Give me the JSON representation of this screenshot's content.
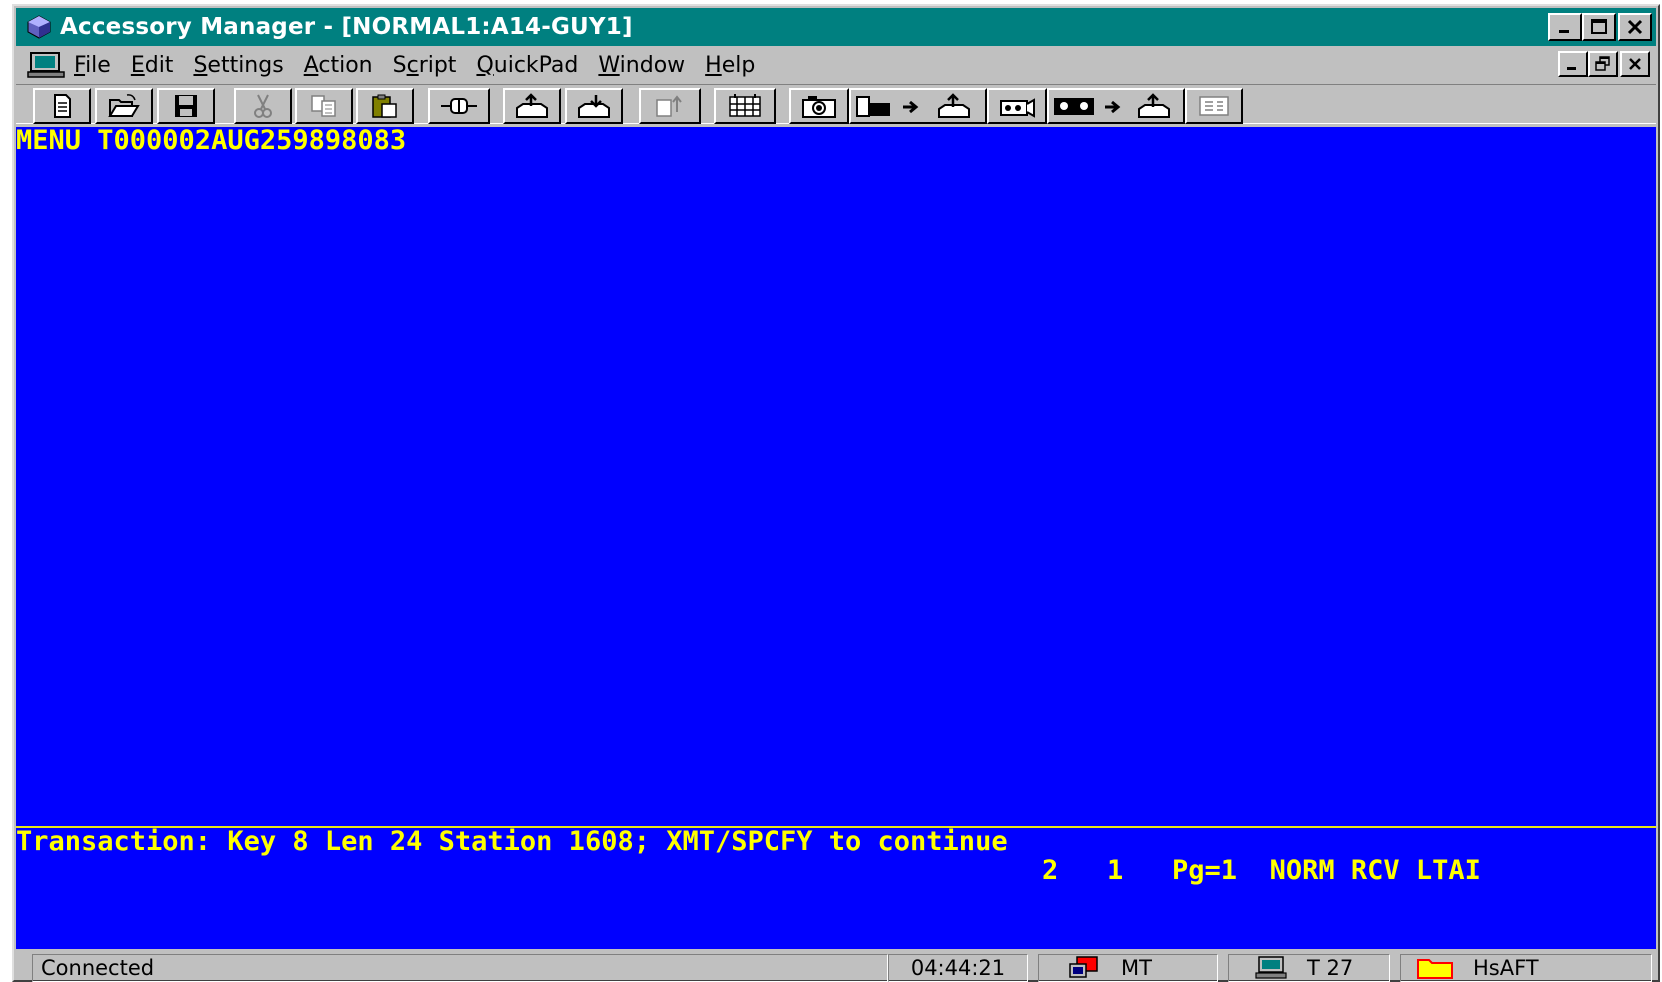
{
  "window": {
    "title": "Accessory Manager - [NORMAL1:A14-GUY1]",
    "titlebar_color": "#008080",
    "app_icon": "app-gem-icon",
    "controls": [
      "minimize-icon",
      "maximize-icon",
      "close-icon"
    ]
  },
  "menubar": {
    "system_icon": "terminal-computer-icon",
    "items": [
      {
        "label": "File",
        "accel": "F",
        "rest": "ile"
      },
      {
        "label": "Edit",
        "accel": "E",
        "rest": "dit"
      },
      {
        "label": "Settings",
        "accel": "S",
        "rest": "ettings"
      },
      {
        "label": "Action",
        "accel": "A",
        "rest": "ction"
      },
      {
        "label": "Script",
        "pre": "S",
        "accel": "c",
        "rest": "ript"
      },
      {
        "label": "QuickPad",
        "accel": "Q",
        "rest": "uickPad"
      },
      {
        "label": "Window",
        "accel": "W",
        "rest": "indow"
      },
      {
        "label": "Help",
        "accel": "H",
        "rest": "elp"
      }
    ],
    "mdi_controls": [
      "mdi-minimize-icon",
      "mdi-restore-icon",
      "mdi-close-icon"
    ]
  },
  "toolbar": {
    "buttons": [
      {
        "name": "new-document-button",
        "icon": "document-icon"
      },
      {
        "name": "open-folder-button",
        "icon": "open-folder-icon"
      },
      {
        "name": "save-button",
        "icon": "floppy-disk-icon"
      },
      {
        "name": "cut-button",
        "icon": "scissors-icon",
        "disabled": true
      },
      {
        "name": "copy-button",
        "icon": "copy-icon"
      },
      {
        "name": "paste-button",
        "icon": "clipboard-icon"
      },
      {
        "name": "connect-button",
        "icon": "plug-connector-icon"
      },
      {
        "name": "send-tray-button",
        "icon": "outbox-tray-icon"
      },
      {
        "name": "receive-tray-button",
        "icon": "inbox-tray-icon"
      },
      {
        "name": "transfer-file-button",
        "icon": "file-transfer-icon",
        "disabled": true
      },
      {
        "name": "keyboard-map-button",
        "icon": "keyboard-grid-icon"
      },
      {
        "name": "capture-screen-button",
        "icon": "camera-icon"
      },
      {
        "name": "print-to-tray-button",
        "icon": "printer-to-tray-icon"
      },
      {
        "name": "record-button",
        "icon": "video-camera-icon"
      },
      {
        "name": "tape-to-tray-button",
        "icon": "cassette-to-tray-icon"
      },
      {
        "name": "grid-view-button",
        "icon": "grid-panel-icon",
        "disabled": true
      }
    ]
  },
  "terminal": {
    "background": "#0000ff",
    "text_color": "#ffff00",
    "header_line": "MENU T000002AUG259898083",
    "transaction_line": "Transaction: Key 8 Len 24 Station 1608; XMT/SPCFY to continue",
    "status_line": "2   1   Pg=1  NORM RCV LTAI"
  },
  "statusbar": {
    "connection": "Connected",
    "time": "04:44:21",
    "mode_icon": "network-terminal-icon",
    "mode": "MT",
    "terminal_icon": "computer-icon",
    "terminal": "T 27",
    "folder_icon": "folder-icon",
    "session": "HsAFT"
  }
}
